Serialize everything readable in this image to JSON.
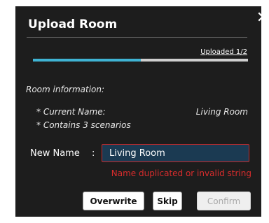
{
  "dialog": {
    "title": "Upload Room",
    "close_icon": "close-icon",
    "close_glyph": "✕"
  },
  "progress": {
    "label": "Uploaded 1/2",
    "fraction": 0.5,
    "fill_color": "#3fb3d3"
  },
  "room_info": {
    "heading": "Room information:",
    "current_name_label": "* Current Name:",
    "current_name_value": "Living Room",
    "scenarios_text": "* Contains 3 scenarios"
  },
  "new_name": {
    "label": "New Name",
    "separator": ":",
    "value": "Living Room",
    "error": "Name duplicated or invalid string"
  },
  "buttons": {
    "overwrite": "Overwrite",
    "skip": "Skip",
    "confirm": "Confirm"
  },
  "colors": {
    "dialog_bg": "#1d1d1d",
    "input_bg": "#1b3a52",
    "error": "#d82c2c"
  }
}
